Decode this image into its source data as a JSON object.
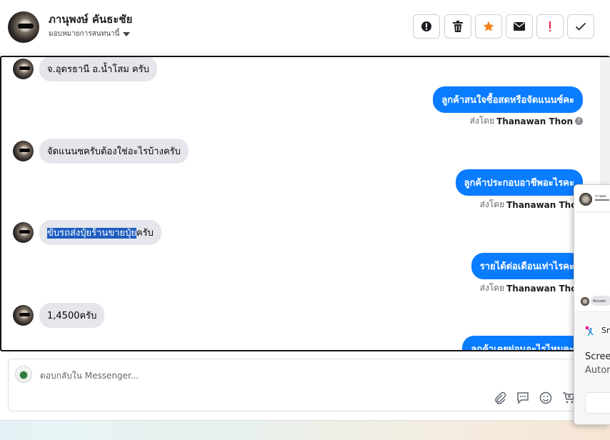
{
  "header": {
    "contact_name": "ภานุพงษ์ คันธะชัย",
    "assign_label": "มอบหมายการสนทนานี้",
    "actions": [
      {
        "icon": "alert-circle-icon"
      },
      {
        "icon": "trash-icon"
      },
      {
        "icon": "star-icon",
        "color": "#f5821f"
      },
      {
        "icon": "envelope-icon"
      },
      {
        "icon": "exclamation-icon",
        "color": "#e41e3f"
      },
      {
        "icon": "checkmark-icon"
      }
    ]
  },
  "conversation": {
    "messages": [
      {
        "direction": "in",
        "text": "จ.อุดรธานี อ.น้ำโสม ครับ"
      },
      {
        "direction": "out",
        "text": "ลูกค้าสนใจซื้อสดหรือจัดแนนซ์คะ",
        "sent_by_label": "ส่งโดย",
        "sender": "Thanawan Thon"
      },
      {
        "direction": "in",
        "text": "จัดแนนซครับต้องใช่อะไรบ้างครับ"
      },
      {
        "direction": "out",
        "text": "ลูกค้าประกอบอาชีพอะไรคะ",
        "sent_by_label": "ส่งโดย",
        "sender": "Thanawan Thon"
      },
      {
        "direction": "in",
        "text_selected": "ขับรถส่งปุ๋ยร้านขายปุ๋ย",
        "text_rest": "ครับ"
      },
      {
        "direction": "out",
        "text": "รายได้ต่อเดือนเท่าไรคะ",
        "sent_by_label": "ส่งโดย",
        "sender": "Thanawan Thon"
      },
      {
        "direction": "in",
        "text": "1,4500ครับ"
      },
      {
        "direction": "out",
        "text": "ลูกค้าเคยผ่อนอะไรไหมคะ"
      }
    ]
  },
  "composer": {
    "placeholder": "ตอบกลับใน Messenger...",
    "icons": [
      "paperclip-icon",
      "quick-reply-icon",
      "emoji-icon",
      "cart-icon"
    ]
  },
  "overlay": {
    "mini_name": "ภานุพง",
    "mini_bubble": "ขับรถส่ง",
    "app_name": "Sn",
    "line1": "Screen",
    "line2": "Autom"
  },
  "colors": {
    "accent_blue": "#0a7cff",
    "incoming_bubble": "#e4e6eb",
    "star": "#f5821f",
    "alert_red": "#e41e3f"
  }
}
